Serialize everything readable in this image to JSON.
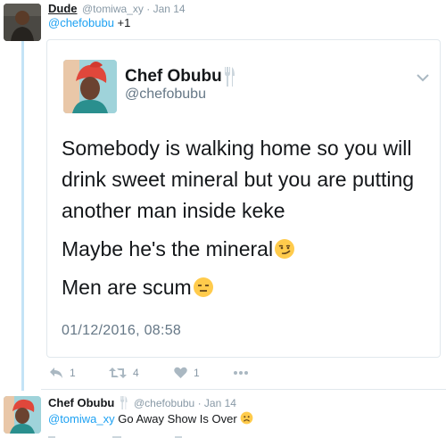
{
  "top_tweet": {
    "author_name": "Dude",
    "author_handle": "@tomiwa_xy",
    "separator": "·",
    "date": "Jan 14",
    "mention": "@chefobubu",
    "reply_text": "+1"
  },
  "quoted_tweet": {
    "author_name": "Chef Obubu",
    "author_handle": "@chefobubu",
    "paragraphs": [
      "Somebody is walking home so you will drink sweet mineral but you are putting another man inside keke",
      "Maybe he's the mineral",
      "Men are scum"
    ],
    "paragraph_emojis": [
      "",
      "smirking-face-emoji",
      "expressionless-face-emoji"
    ],
    "timestamp": "01/12/2016, 08:58",
    "icons": {
      "verified_or_badge": "fork-knife-icon",
      "menu": "chevron-down-icon"
    }
  },
  "actions": {
    "reply_count": "1",
    "retweet_count": "4",
    "like_count": "1",
    "icons": [
      "reply-icon",
      "retweet-icon",
      "heart-icon",
      "more-icon"
    ]
  },
  "bottom_tweet": {
    "author_name": "Chef Obubu",
    "author_handle": "@chefobubu",
    "separator": "·",
    "date": "Jan 14",
    "mention": "@tomiwa_xy",
    "reply_text": "Go Away Show Is Over",
    "emoji": "worried-face-emoji"
  },
  "colors": {
    "link": "#1da1f2",
    "secondary_text": "#8899a6",
    "thread_line": "#c4e3f6",
    "border": "#e1e8ed"
  }
}
